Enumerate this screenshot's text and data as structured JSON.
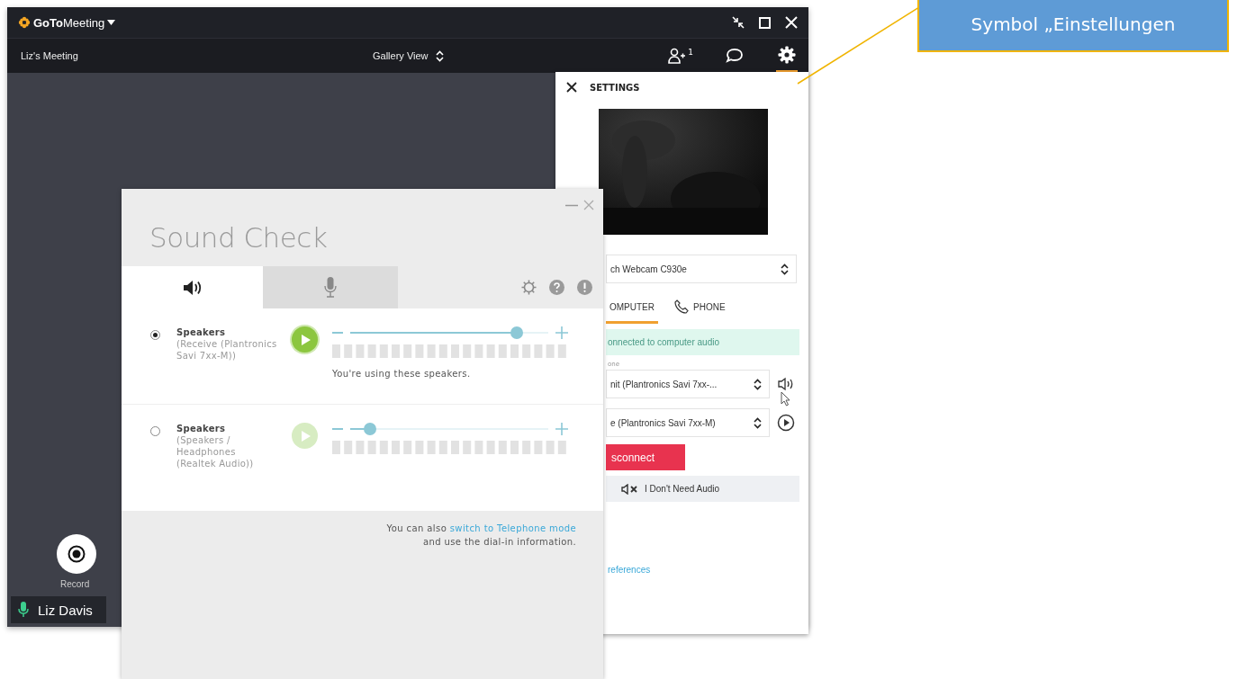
{
  "window": {
    "app_name": "**GoTo**Meeting",
    "meeting_title": "Liz's Meeting",
    "view_mode": "Gallery View",
    "participant_count": "1"
  },
  "record": {
    "label": "Record"
  },
  "participant": {
    "name": "Liz Davis",
    "muted": false
  },
  "settings": {
    "title": "SETTINGS",
    "camera": "ch Webcam C930e",
    "audio_tabs": [
      {
        "label": "OMPUTER",
        "kind": "computer",
        "selected": true
      },
      {
        "label": "PHONE",
        "kind": "phone",
        "selected": false
      }
    ],
    "status": "onnected to computer audio",
    "mic_label": "one",
    "microphone": "nit (Plantronics Savi 7xx-...",
    "speaker": "e (Plantronics Savi 7xx-M)",
    "disconnect": "sconnect",
    "no_audio": "I Don't Need Audio",
    "preferences_link": "references"
  },
  "sound_check": {
    "title": "Sound Check",
    "tabs": [
      {
        "kind": "speaker",
        "selected": true
      },
      {
        "kind": "microphone",
        "selected": false
      }
    ],
    "devices": [
      {
        "name": "Speakers",
        "detail": "(Receive (Plantronics Savi 7xx-M))",
        "selected": true,
        "level": 0.84,
        "note": "You're using these speakers."
      },
      {
        "name": "Speakers",
        "detail": "(Speakers / Headphones (Realtek Audio))",
        "selected": false,
        "level": 0.1
      }
    ],
    "footer_before": "You can also",
    "footer_link": "switch to Telephone mode",
    "footer_after": "and use the dial-in information."
  },
  "callout": {
    "text": "Symbol „Einstellungen"
  }
}
